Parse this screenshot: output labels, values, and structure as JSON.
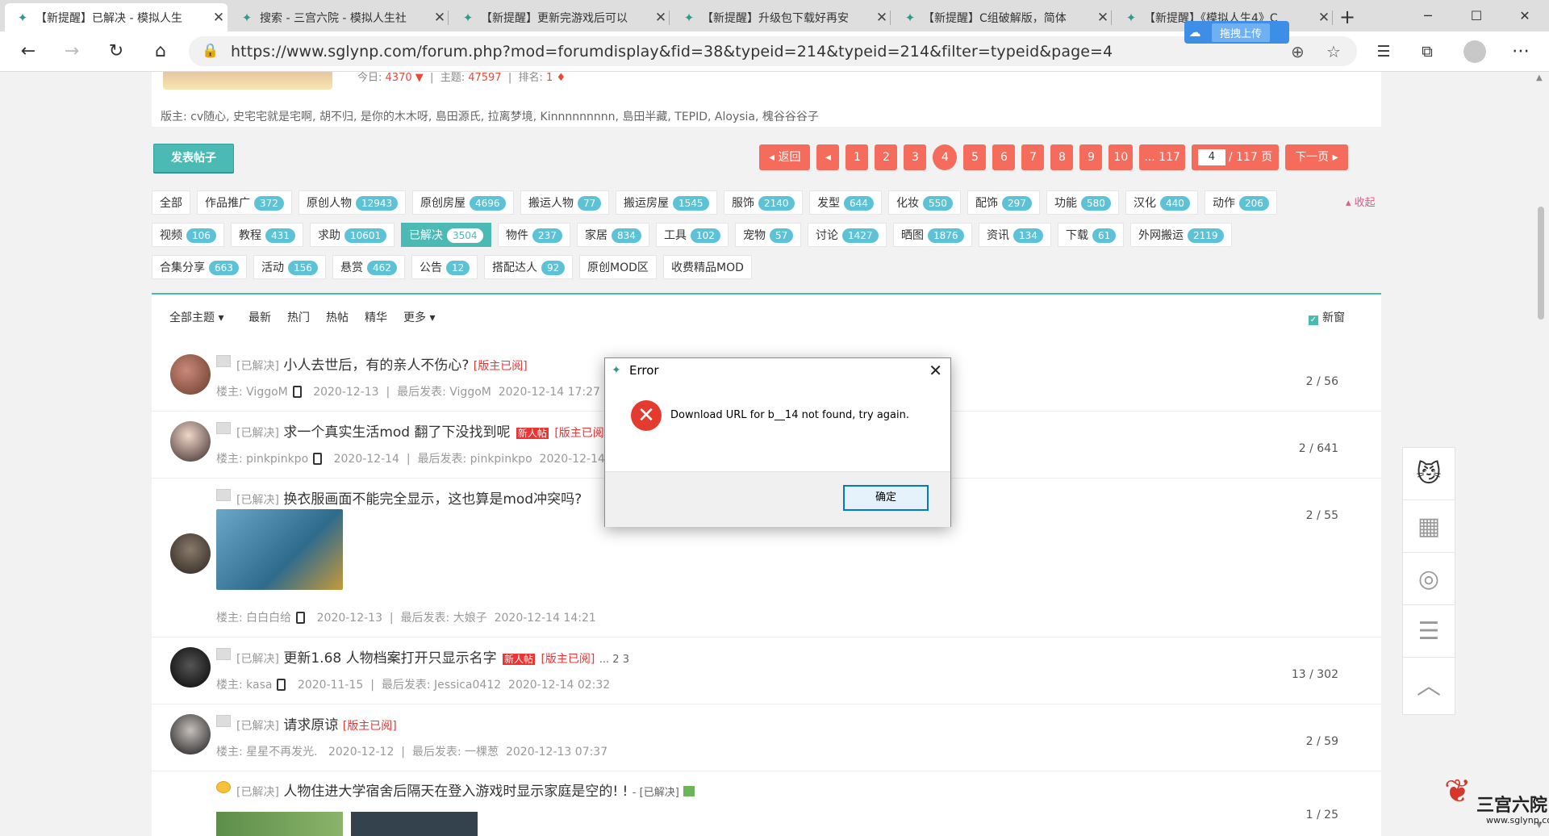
{
  "browser": {
    "tabs": [
      {
        "title": "【新提醒】已解决 - 模拟人生",
        "active": true
      },
      {
        "title": "搜索 - 三宫六院 - 模拟人生社"
      },
      {
        "title": "【新提醒】更新完游戏后可以"
      },
      {
        "title": "【新提醒】升级包下载好再安"
      },
      {
        "title": "【新提醒】C组破解版，简体"
      },
      {
        "title": "【新提醒】《模拟人生4》C"
      }
    ],
    "new_tab": "+",
    "window_controls": {
      "minimize": "─",
      "maximize": "☐",
      "close": "✕"
    },
    "upload_badge": "拖拽上传",
    "url": "https://www.sglynp.com/forum.php?mod=forumdisplay&fid=38&typeid=214&typeid=214&filter=typeid&page=4"
  },
  "forum": {
    "stats": {
      "today_label": "今日:",
      "today": "4370",
      "topics_label": "主题:",
      "topics": "47597",
      "rank_label": "排名:",
      "rank": "1"
    },
    "moderators": "版主: cv随心, 史宅宅就是宅啊, 胡不归, 是你的木木呀, 島田源氏, 拉离梦境, Kinnnnnnnnn, 島田半藏, TEPID, Aloysia, 槐谷谷谷子",
    "post_button": "发表帖子",
    "pager": {
      "back": "◂ 返回",
      "prev": "◂",
      "pages": [
        "1",
        "2",
        "3",
        "4",
        "5",
        "6",
        "7",
        "8",
        "9",
        "10",
        "... 117"
      ],
      "current": "4",
      "jump_value": "4",
      "jump_total": "/ 117 页",
      "next": "下一页 ▸"
    },
    "categories": [
      {
        "label": "全部",
        "count": ""
      },
      {
        "label": "作品推广",
        "count": "372"
      },
      {
        "label": "原创人物",
        "count": "12943"
      },
      {
        "label": "原创房屋",
        "count": "4696"
      },
      {
        "label": "搬运人物",
        "count": "77"
      },
      {
        "label": "搬运房屋",
        "count": "1545"
      },
      {
        "label": "服饰",
        "count": "2140"
      },
      {
        "label": "发型",
        "count": "644"
      },
      {
        "label": "化妆",
        "count": "550"
      },
      {
        "label": "配饰",
        "count": "297"
      },
      {
        "label": "功能",
        "count": "580"
      },
      {
        "label": "汉化",
        "count": "440"
      },
      {
        "label": "动作",
        "count": "206"
      },
      {
        "label": "视频",
        "count": "106"
      },
      {
        "label": "教程",
        "count": "431"
      },
      {
        "label": "求助",
        "count": "10601"
      },
      {
        "label": "已解决",
        "count": "3504"
      },
      {
        "label": "物件",
        "count": "237"
      },
      {
        "label": "家居",
        "count": "834"
      },
      {
        "label": "工具",
        "count": "102"
      },
      {
        "label": "宠物",
        "count": "57"
      },
      {
        "label": "讨论",
        "count": "1427"
      },
      {
        "label": "晒图",
        "count": "1876"
      },
      {
        "label": "资讯",
        "count": "134"
      },
      {
        "label": "下载",
        "count": "61"
      },
      {
        "label": "外网搬运",
        "count": "2119"
      },
      {
        "label": "合集分享",
        "count": "663"
      },
      {
        "label": "活动",
        "count": "156"
      },
      {
        "label": "悬赏",
        "count": "462"
      },
      {
        "label": "公告",
        "count": "12"
      },
      {
        "label": "搭配达人",
        "count": "92"
      },
      {
        "label": "原创MOD区",
        "count": ""
      },
      {
        "label": "收费精品MOD",
        "count": ""
      }
    ],
    "collapse": "▴ 收起",
    "filters": {
      "all": "全部主题 ▾",
      "latest": "最新",
      "hot": "热门",
      "hot_posts": "热帖",
      "digest": "精华",
      "more": "更多 ▾",
      "new_window": "新窗"
    },
    "threads": [
      {
        "tag": "[已解决]",
        "title": "小人去世后，有的亲人不伤心?",
        "badge_read": "[版主已阅]",
        "author": "楼主: ViggoM",
        "date": "2020-12-13",
        "last": "最后发表: ViggoM",
        "last_date": "2020-12-14 17:27",
        "count": "2 / 56"
      },
      {
        "tag": "[已解决]",
        "title": "求一个真实生活mod 翻了下没找到呢",
        "new_badge": "新人帖",
        "badge_read": "[版主已阅",
        "author": "楼主: pinkpinkpo",
        "date": "2020-12-14",
        "last": "最后发表: pinkpinkpo",
        "last_date": "2020-12-14",
        "count": "2 / 641"
      },
      {
        "tag": "[已解决]",
        "title": "换衣服画面不能完全显示，这也算是mod冲突吗?",
        "author": "楼主: 白白白给",
        "date": "2020-12-13",
        "last": "最后发表: 大娘子",
        "last_date": "2020-12-14 14:21",
        "count": "2 / 55"
      },
      {
        "tag": "[已解决]",
        "title": "更新1.68 人物档案打开只显示名字",
        "new_badge": "新人帖",
        "badge_read": "[版主已阅]",
        "pages": "... 2  3",
        "author": "楼主: kasa",
        "date": "2020-11-15",
        "last": "最后发表: Jessica0412",
        "last_date": "2020-12-14 02:32",
        "count": "13 / 302"
      },
      {
        "tag": "[已解决]",
        "title": "请求原谅",
        "badge_read": "[版主已阅]",
        "author": "楼主: 星星不再发光.",
        "date": "2020-12-12",
        "last": "最后发表: 一棵葱",
        "last_date": "2020-12-13 07:37",
        "count": "2 / 59"
      },
      {
        "tag": "[已解决]",
        "title": "人物住进大学宿舍后隔天在登入游戏时显示家庭是空的! !",
        "suffix": "- [已解决]",
        "count": "1 / 25"
      }
    ]
  },
  "dialog": {
    "title": "Error",
    "message": "Download URL for b__14 not found, try again.",
    "ok": "确定"
  },
  "brand": {
    "name": "三宫六院",
    "url": "www.sglynp.com"
  }
}
